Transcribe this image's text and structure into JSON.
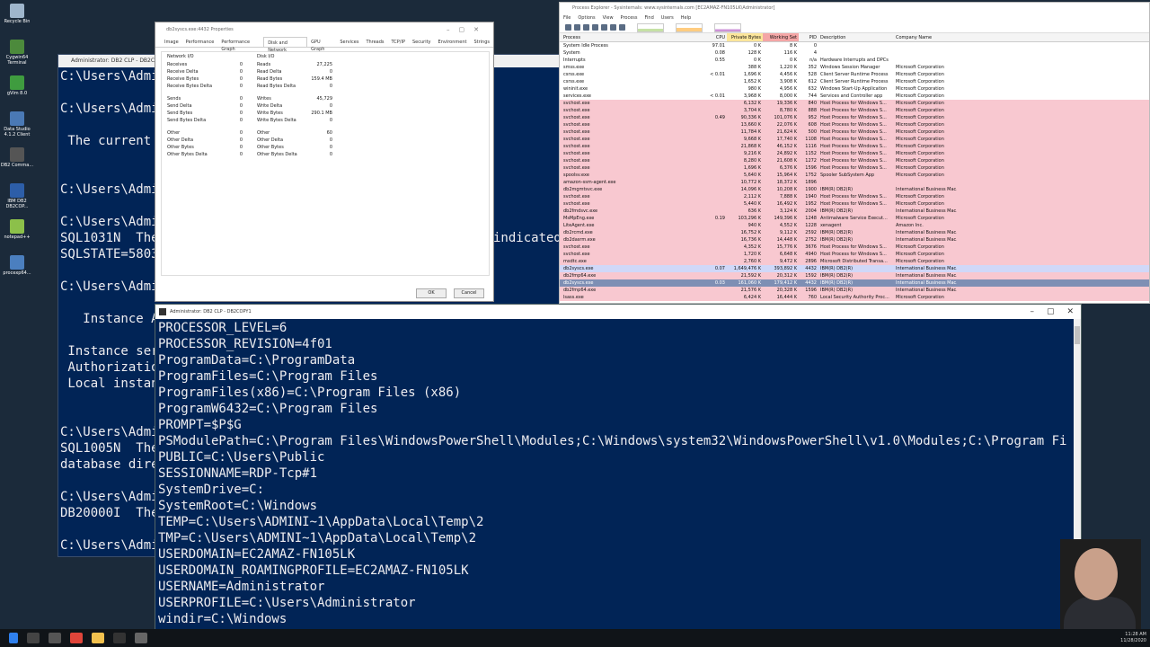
{
  "desktop_icons": [
    {
      "label": "Recycle Bin",
      "color": "#9fb6cc"
    },
    {
      "label": "Cygwin64 Terminal",
      "color": "#4c8a3c"
    },
    {
      "label": "gVim 8.0",
      "color": "#3f9c3f"
    },
    {
      "label": "Data Studio 4.1.2 Client",
      "color": "#4a79b5"
    },
    {
      "label": "DB2 Comma...",
      "color": "#555555"
    },
    {
      "label": "IBM DB2 DB2COP...",
      "color": "#2d5ea8"
    },
    {
      "label": "notepad++",
      "color": "#8cc04a"
    },
    {
      "label": "procexp64...",
      "color": "#4b7fbf"
    }
  ],
  "bg_console": {
    "title": "Administrator: DB2 CLP - DB2COPY1",
    "lines": [
      "C:\\Users\\Admi",
      "C:\\Users\\Admi",
      " The current",
      "C:\\Users\\Admi",
      "C:\\Users\\Admi",
      "SQL1031N  The",
      "SQLSTATE=5803",
      "C:\\Users\\Admi",
      "   Instance A",
      " Instance ser",
      " Authorizatio",
      " Local instan",
      "C:\\Users\\Admi",
      "SQL1005N  The",
      "database dire",
      "C:\\Users\\Admi",
      "DB20000I  The",
      "C:\\Users\\Admi"
    ],
    "right_fragment": "indicated"
  },
  "props_dialog": {
    "title": "db2syscs.exe:4432 Properties",
    "tabs": [
      "Image",
      "Performance",
      "Performance Graph",
      "Disk and Network",
      "GPU Graph",
      "Services",
      "Threads",
      "TCP/IP",
      "Security",
      "Environment",
      "Strings"
    ],
    "active_tab": "Disk and Network",
    "network": {
      "title": "Network I/O",
      "rows": [
        {
          "k": "Receives",
          "v": "0"
        },
        {
          "k": "Receive Delta",
          "v": "0"
        },
        {
          "k": "Receive Bytes",
          "v": "0"
        },
        {
          "k": "Receive Bytes Delta",
          "v": "0"
        },
        {
          "k": "Sends",
          "v": "0"
        },
        {
          "k": "Send Delta",
          "v": "0"
        },
        {
          "k": "Send Bytes",
          "v": "0"
        },
        {
          "k": "Send Bytes Delta",
          "v": "0"
        },
        {
          "k": "Other",
          "v": "0"
        },
        {
          "k": "Other Delta",
          "v": "0"
        },
        {
          "k": "Other Bytes",
          "v": "0"
        },
        {
          "k": "Other Bytes Delta",
          "v": "0"
        }
      ]
    },
    "disk": {
      "title": "Disk I/O",
      "rows": [
        {
          "k": "Reads",
          "v": "27,225"
        },
        {
          "k": "Read Delta",
          "v": "0"
        },
        {
          "k": "Read Bytes",
          "v": "159.4 MB"
        },
        {
          "k": "Read Bytes Delta",
          "v": "0"
        },
        {
          "k": "Writes",
          "v": "45,729"
        },
        {
          "k": "Write Delta",
          "v": "0"
        },
        {
          "k": "Write Bytes",
          "v": "290.1 MB"
        },
        {
          "k": "Write Bytes Delta",
          "v": "0"
        },
        {
          "k": "Other",
          "v": "60"
        },
        {
          "k": "Other Delta",
          "v": "0"
        },
        {
          "k": "Other Bytes",
          "v": "0"
        },
        {
          "k": "Other Bytes Delta",
          "v": "0"
        }
      ]
    },
    "ok_label": "OK",
    "cancel_label": "Cancel"
  },
  "process_explorer": {
    "title": "Process Explorer - Sysinternals: www.sysinternals.com [EC2AMAZ-FN105LK\\Administrator]",
    "menu": [
      "File",
      "Options",
      "View",
      "Process",
      "Find",
      "Users",
      "Help"
    ],
    "columns": [
      "Process",
      "CPU",
      "Private Bytes",
      "Working Set",
      "PID",
      "Description",
      "Company Name"
    ],
    "rows": [
      {
        "p": "System Idle Process",
        "cpu": "97.01",
        "priv": "0 K",
        "ws": "8 K",
        "pid": "0",
        "desc": "",
        "comp": "",
        "t": ""
      },
      {
        "p": "System",
        "cpu": "0.08",
        "priv": "128 K",
        "ws": "116 K",
        "pid": "4",
        "desc": "",
        "comp": "",
        "t": ""
      },
      {
        "p": "Interrupts",
        "cpu": "0.55",
        "priv": "0 K",
        "ws": "0 K",
        "pid": "n/a",
        "desc": "Hardware Interrupts and DPCs",
        "comp": "",
        "t": ""
      },
      {
        "p": "smss.exe",
        "cpu": "",
        "priv": "388 K",
        "ws": "1,220 K",
        "pid": "352",
        "desc": "Windows Session Manager",
        "comp": "Microsoft Corporation",
        "t": ""
      },
      {
        "p": "csrss.exe",
        "cpu": "< 0.01",
        "priv": "1,696 K",
        "ws": "4,456 K",
        "pid": "528",
        "desc": "Client Server Runtime Process",
        "comp": "Microsoft Corporation",
        "t": ""
      },
      {
        "p": "csrss.exe",
        "cpu": "",
        "priv": "1,652 K",
        "ws": "3,908 K",
        "pid": "612",
        "desc": "Client Server Runtime Process",
        "comp": "Microsoft Corporation",
        "t": ""
      },
      {
        "p": "wininit.exe",
        "cpu": "",
        "priv": "980 K",
        "ws": "4,956 K",
        "pid": "632",
        "desc": "Windows Start-Up Application",
        "comp": "Microsoft Corporation",
        "t": ""
      },
      {
        "p": "services.exe",
        "cpu": "< 0.01",
        "priv": "3,968 K",
        "ws": "8,000 K",
        "pid": "744",
        "desc": "Services and Controller app",
        "comp": "Microsoft Corporation",
        "t": ""
      },
      {
        "p": "svchost.exe",
        "cpu": "",
        "priv": "6,132 K",
        "ws": "19,336 K",
        "pid": "840",
        "desc": "Host Process for Windows S...",
        "comp": "Microsoft Corporation",
        "t": "svc"
      },
      {
        "p": "svchost.exe",
        "cpu": "",
        "priv": "3,704 K",
        "ws": "8,780 K",
        "pid": "888",
        "desc": "Host Process for Windows S...",
        "comp": "Microsoft Corporation",
        "t": "svc"
      },
      {
        "p": "svchost.exe",
        "cpu": "0.49",
        "priv": "90,336 K",
        "ws": "101,076 K",
        "pid": "952",
        "desc": "Host Process for Windows S...",
        "comp": "Microsoft Corporation",
        "t": "svc"
      },
      {
        "p": "svchost.exe",
        "cpu": "",
        "priv": "13,660 K",
        "ws": "22,076 K",
        "pid": "608",
        "desc": "Host Process for Windows S...",
        "comp": "Microsoft Corporation",
        "t": "svc"
      },
      {
        "p": "svchost.exe",
        "cpu": "",
        "priv": "11,784 K",
        "ws": "21,624 K",
        "pid": "500",
        "desc": "Host Process for Windows S...",
        "comp": "Microsoft Corporation",
        "t": "svc"
      },
      {
        "p": "svchost.exe",
        "cpu": "",
        "priv": "9,668 K",
        "ws": "17,740 K",
        "pid": "1108",
        "desc": "Host Process for Windows S...",
        "comp": "Microsoft Corporation",
        "t": "svc"
      },
      {
        "p": "svchost.exe",
        "cpu": "",
        "priv": "21,868 K",
        "ws": "46,152 K",
        "pid": "1116",
        "desc": "Host Process for Windows S...",
        "comp": "Microsoft Corporation",
        "t": "svc"
      },
      {
        "p": "svchost.exe",
        "cpu": "",
        "priv": "9,216 K",
        "ws": "24,892 K",
        "pid": "1152",
        "desc": "Host Process for Windows S...",
        "comp": "Microsoft Corporation",
        "t": "svc"
      },
      {
        "p": "svchost.exe",
        "cpu": "",
        "priv": "8,280 K",
        "ws": "21,608 K",
        "pid": "1272",
        "desc": "Host Process for Windows S...",
        "comp": "Microsoft Corporation",
        "t": "svc"
      },
      {
        "p": "svchost.exe",
        "cpu": "",
        "priv": "1,696 K",
        "ws": "6,376 K",
        "pid": "1596",
        "desc": "Host Process for Windows S...",
        "comp": "Microsoft Corporation",
        "t": "svc"
      },
      {
        "p": "spoolsv.exe",
        "cpu": "",
        "priv": "5,640 K",
        "ws": "15,964 K",
        "pid": "1752",
        "desc": "Spooler SubSystem App",
        "comp": "Microsoft Corporation",
        "t": "svc"
      },
      {
        "p": "amazon-ssm-agent.exe",
        "cpu": "",
        "priv": "10,772 K",
        "ws": "18,372 K",
        "pid": "1896",
        "desc": "",
        "comp": "",
        "t": "svc"
      },
      {
        "p": "db2mgmtsvc.exe",
        "cpu": "",
        "priv": "14,096 K",
        "ws": "10,208 K",
        "pid": "1900",
        "desc": "IBM(R) DB2(R)",
        "comp": "International Business Mac...",
        "t": "svc"
      },
      {
        "p": "svchost.exe",
        "cpu": "",
        "priv": "2,112 K",
        "ws": "7,888 K",
        "pid": "1940",
        "desc": "Host Process for Windows S...",
        "comp": "Microsoft Corporation",
        "t": "svc"
      },
      {
        "p": "svchost.exe",
        "cpu": "",
        "priv": "5,440 K",
        "ws": "16,492 K",
        "pid": "1952",
        "desc": "Host Process for Windows S...",
        "comp": "Microsoft Corporation",
        "t": "svc"
      },
      {
        "p": "db2fmdsvc.exe",
        "cpu": "",
        "priv": "636 K",
        "ws": "3,124 K",
        "pid": "2004",
        "desc": "IBM(R) DB2(R)",
        "comp": "International Business Mac...",
        "t": "svc"
      },
      {
        "p": "MsMpEng.exe",
        "cpu": "0.19",
        "priv": "103,296 K",
        "ws": "149,396 K",
        "pid": "1248",
        "desc": "Antimalware Service Execut...",
        "comp": "Microsoft Corporation",
        "t": "svc"
      },
      {
        "p": "LiteAgent.exe",
        "cpu": "",
        "priv": "940 K",
        "ws": "4,552 K",
        "pid": "1228",
        "desc": "xenagent",
        "comp": "Amazon Inc.",
        "t": "svc"
      },
      {
        "p": "db2rcmd.exe",
        "cpu": "",
        "priv": "16,752 K",
        "ws": "9,112 K",
        "pid": "2592",
        "desc": "IBM(R) DB2(R)",
        "comp": "International Business Mac...",
        "t": "svc"
      },
      {
        "p": "db2dasrm.exe",
        "cpu": "",
        "priv": "16,736 K",
        "ws": "14,448 K",
        "pid": "2752",
        "desc": "IBM(R) DB2(R)",
        "comp": "International Business Mac...",
        "t": "svc"
      },
      {
        "p": "svchost.exe",
        "cpu": "",
        "priv": "4,352 K",
        "ws": "15,776 K",
        "pid": "3676",
        "desc": "Host Process for Windows S...",
        "comp": "Microsoft Corporation",
        "t": "svc"
      },
      {
        "p": "svchost.exe",
        "cpu": "",
        "priv": "1,720 K",
        "ws": "6,648 K",
        "pid": "4940",
        "desc": "Host Process for Windows S...",
        "comp": "Microsoft Corporation",
        "t": "svc"
      },
      {
        "p": "msdtc.exe",
        "cpu": "",
        "priv": "2,760 K",
        "ws": "9,472 K",
        "pid": "2896",
        "desc": "Microsoft Distributed Transa...",
        "comp": "Microsoft Corporation",
        "t": "svc"
      },
      {
        "p": "db2syscs.exe",
        "cpu": "0.07",
        "priv": "1,649,476 K",
        "ws": "393,892 K",
        "pid": "4432",
        "desc": "IBM(R) DB2(R)",
        "comp": "International Business Mac...",
        "t": "dbg"
      },
      {
        "p": "db2fmp64.exe",
        "cpu": "",
        "priv": "21,592 K",
        "ws": "20,312 K",
        "pid": "1592",
        "desc": "IBM(R) DB2(R)",
        "comp": "International Business Mac...",
        "t": "svc"
      },
      {
        "p": "db2syscs.exe",
        "cpu": "0.03",
        "priv": "161,060 K",
        "ws": "179,412 K",
        "pid": "4432",
        "desc": "IBM(R) DB2(R)",
        "comp": "International Business Mac...",
        "t": "hl"
      },
      {
        "p": "db2fmp64.exe",
        "cpu": "",
        "priv": "21,576 K",
        "ws": "20,328 K",
        "pid": "1596",
        "desc": "IBM(R) DB2(R)",
        "comp": "International Business Mac...",
        "t": "svc"
      },
      {
        "p": "lsass.exe",
        "cpu": "",
        "priv": "6,424 K",
        "ws": "16,444 K",
        "pid": "760",
        "desc": "Local Security Authority Proc...",
        "comp": "Microsoft Corporation",
        "t": "svc"
      }
    ]
  },
  "console": {
    "title": "Administrator: DB2 CLP - DB2COPY1",
    "lines": [
      "PROCESSOR_LEVEL=6",
      "PROCESSOR_REVISION=4f01",
      "ProgramData=C:\\ProgramData",
      "ProgramFiles=C:\\Program Files",
      "ProgramFiles(x86)=C:\\Program Files (x86)",
      "ProgramW6432=C:\\Program Files",
      "PROMPT=$P$G",
      "PSModulePath=C:\\Program Files\\WindowsPowerShell\\Modules;C:\\Windows\\system32\\WindowsPowerShell\\v1.0\\Modules;C:\\Program Fi",
      "PUBLIC=C:\\Users\\Public",
      "SESSIONNAME=RDP-Tcp#1",
      "SystemDrive=C:",
      "SystemRoot=C:\\Windows",
      "TEMP=C:\\Users\\ADMINI~1\\AppData\\Local\\Temp\\2",
      "TMP=C:\\Users\\ADMINI~1\\AppData\\Local\\Temp\\2",
      "USERDOMAIN=EC2AMAZ-FN105LK",
      "USERDOMAIN_ROAMINGPROFILE=EC2AMAZ-FN105LK",
      "USERNAME=Administrator",
      "USERPROFILE=C:\\Users\\Administrator",
      "windir=C:\\Windows"
    ]
  },
  "taskbar": {
    "time": "11:28 AM",
    "date": "11/28/2020"
  }
}
